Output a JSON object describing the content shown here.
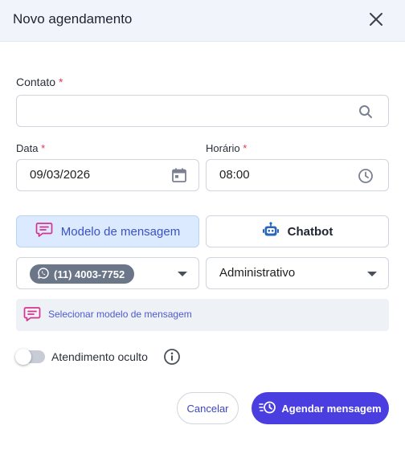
{
  "header": {
    "title": "Novo agendamento"
  },
  "contact": {
    "label": "Contato",
    "required_mark": "*",
    "value": ""
  },
  "date": {
    "label": "Data",
    "required_mark": "*",
    "value": "09/03/2026"
  },
  "time": {
    "label": "Horário",
    "required_mark": "*",
    "value": "08:00"
  },
  "mode_tabs": [
    {
      "label": "Modelo de mensagem",
      "selected": true,
      "icon": "message-template-icon"
    },
    {
      "label": "Chatbot",
      "selected": false,
      "icon": "robot-icon"
    }
  ],
  "channel_select": {
    "value": "(11) 4003-7752",
    "icon": "whatsapp-icon"
  },
  "department_select": {
    "value": "Administrativo"
  },
  "template_picker": {
    "label": "Selecionar modelo de mensagem"
  },
  "hidden_service": {
    "label": "Atendimento oculto",
    "enabled": false
  },
  "actions": {
    "cancel_label": "Cancelar",
    "schedule_label": "Agendar mensagem"
  },
  "colors": {
    "primary": "#4a3ee0",
    "selected_tab_bg": "#dceaff",
    "template_icon": "#d5348c",
    "robot_icon": "#2a66b8",
    "required": "#e53950"
  }
}
